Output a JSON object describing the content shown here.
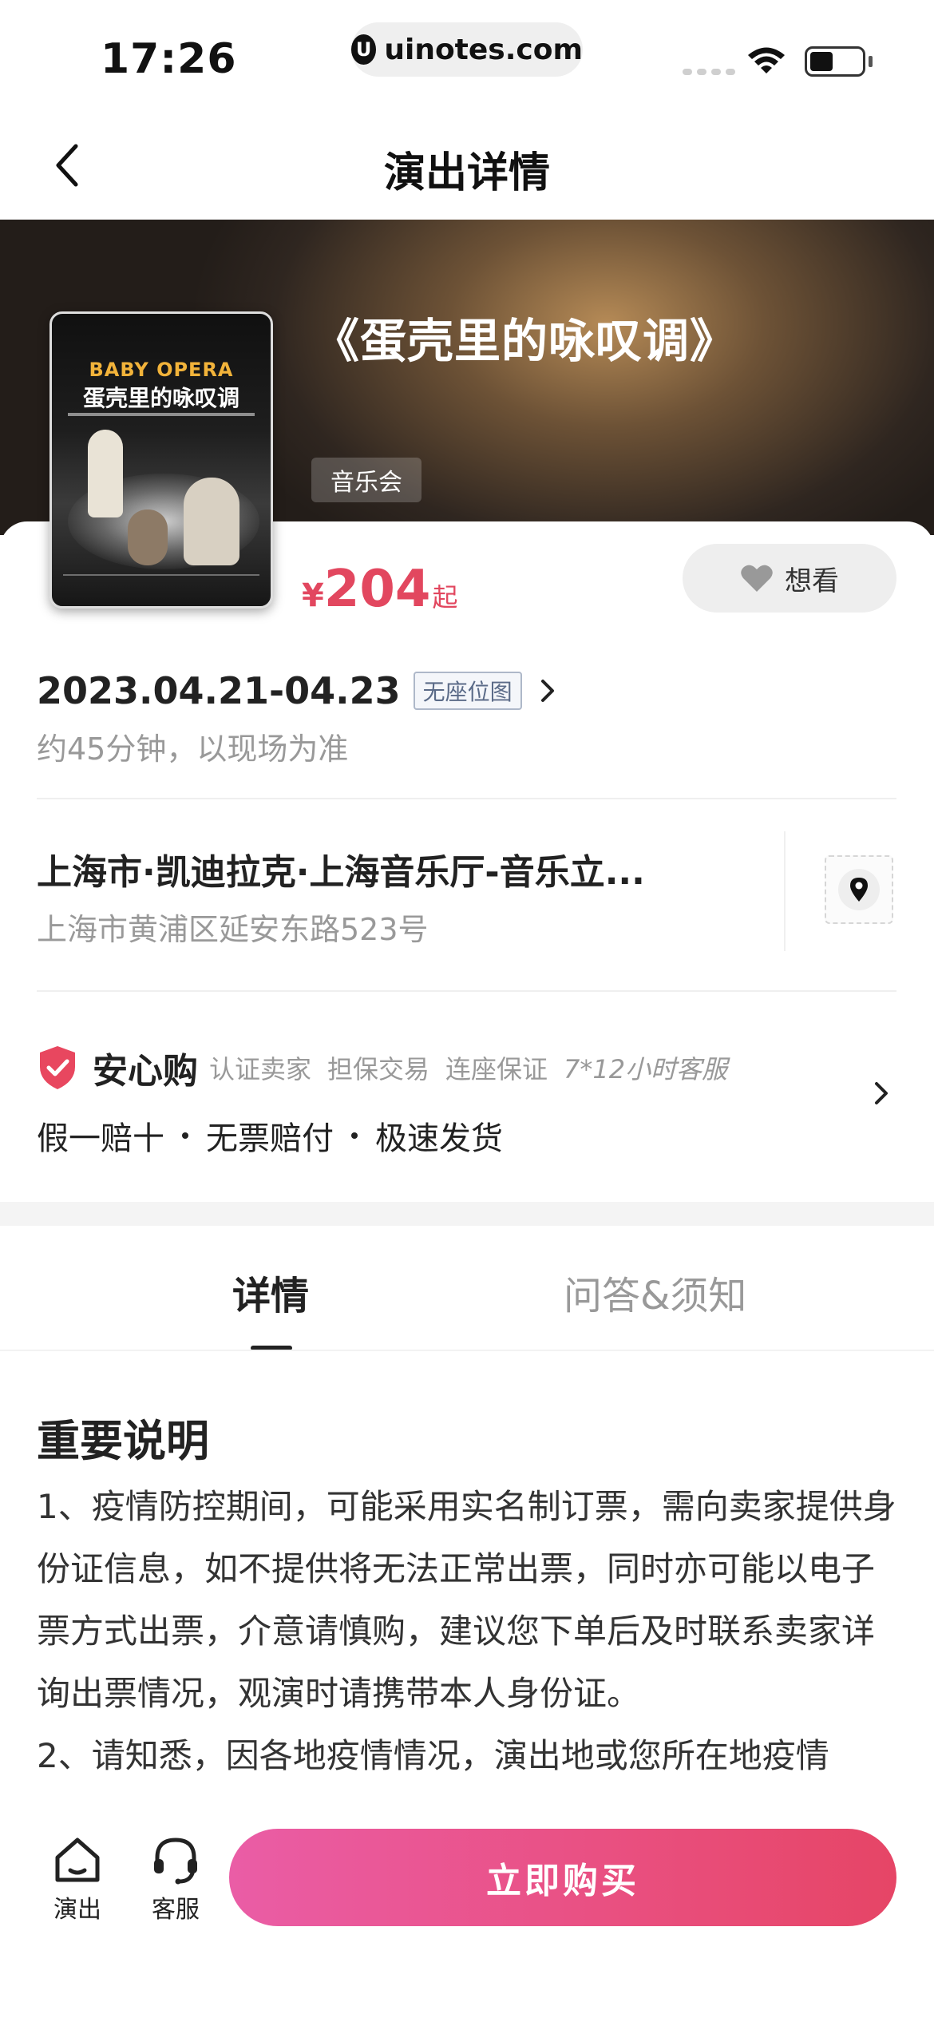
{
  "status_bar": {
    "time": "17:26",
    "url": "uinotes.com",
    "url_logo": "U"
  },
  "nav": {
    "title": "演出详情",
    "back_icon": "chevron-left-icon"
  },
  "hero": {
    "title": "《蛋壳里的咏叹调》",
    "tag": "音乐会"
  },
  "poster": {
    "title_en": "BABY OPERA",
    "title_cn": "蛋壳里的咏叹调"
  },
  "price": {
    "symbol": "¥",
    "amount": "204",
    "suffix": "起"
  },
  "want_button": {
    "label": "想看",
    "icon": "heart-icon"
  },
  "schedule": {
    "date": "2023.04.21-04.23",
    "seat_badge": "无座位图",
    "duration": "约45分钟，以现场为准"
  },
  "venue": {
    "name": "上海市·凯迪拉克·上海音乐厅-音乐立...",
    "address": "上海市黄浦区延安东路523号",
    "map_icon": "location-pin-icon"
  },
  "assurance": {
    "title": "安心购",
    "items": [
      "认证卖家",
      "担保交易",
      "连座保证",
      "7*12小时客服"
    ],
    "features": [
      "假一赔十",
      "无票赔付",
      "极速发货"
    ],
    "colors": {
      "shield": "#e8475f"
    }
  },
  "tabs": [
    {
      "label": "详情",
      "active": true
    },
    {
      "label": "问答&须知",
      "active": false
    }
  ],
  "content": {
    "section_title": "重要说明",
    "paragraphs": [
      "1、疫情防控期间，可能采用实名制订票，需向卖家提供身份证信息，如不提供将无法正常出票，同时亦可能以电子票方式出票，介意请慎购，建议您下单后及时联系卖家详询出票情况，观演时请携带本人身份证。",
      "2、请知悉，因各地疫情情况，演出地或您所在地疫情"
    ]
  },
  "bottom_bar": {
    "home": {
      "label": "演出",
      "icon": "home-icon"
    },
    "service": {
      "label": "客服",
      "icon": "headset-icon"
    },
    "buy_label": "立即购买",
    "colors": {
      "buy_start": "#ea5da6",
      "buy_end": "#e64566"
    }
  },
  "colors": {
    "accent": "#e2475f"
  }
}
